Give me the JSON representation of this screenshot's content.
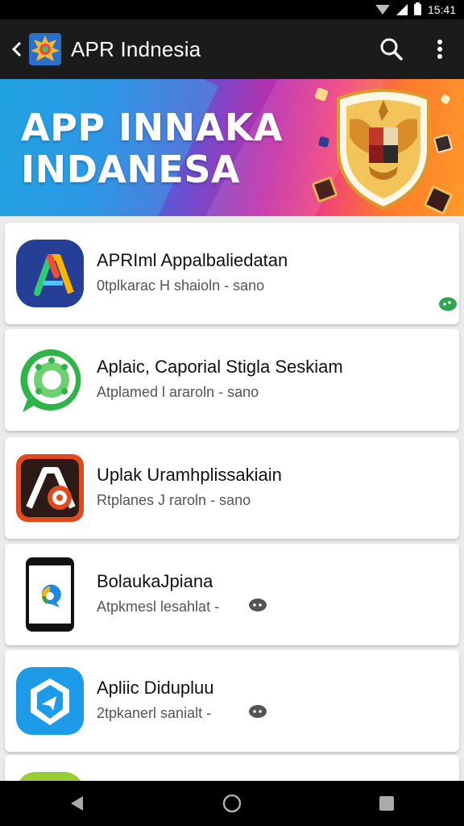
{
  "status_bar": {
    "time": "15:41"
  },
  "app_bar": {
    "title": "APR Indnesia"
  },
  "banner": {
    "title_line1": "APP INNAKA",
    "title_line2": "INDANESA"
  },
  "apps": [
    {
      "name": "APRIml Appalbaliedatan",
      "subtitle": "0tplkarac H shaioln - sano",
      "icon": "blue-a-logo-icon"
    },
    {
      "name": "Aplaic, Caporial Stigla Seskiam",
      "subtitle": "Atplamed l araroln - sano",
      "icon": "green-chat-bubble-icon"
    },
    {
      "name": "Uplak Uramhplissakiain",
      "subtitle": "Rtplanes J raroln - sano",
      "icon": "orange-a-logo-icon"
    },
    {
      "name": "BolaukaJpiana",
      "subtitle": "Atpkmesl lesahlat -",
      "icon": "phone-app-icon"
    },
    {
      "name": "Apliic Didupluu",
      "subtitle": "2tpkanerl sanialt -",
      "icon": "blue-shield-icon"
    },
    {
      "name": "",
      "subtitle": "",
      "icon": "green-app-icon"
    }
  ],
  "colors": {
    "app_bar": "#1b1b1b",
    "status_bar": "#000000",
    "accent_green": "#2ea44f",
    "card_bg": "#ffffff"
  }
}
